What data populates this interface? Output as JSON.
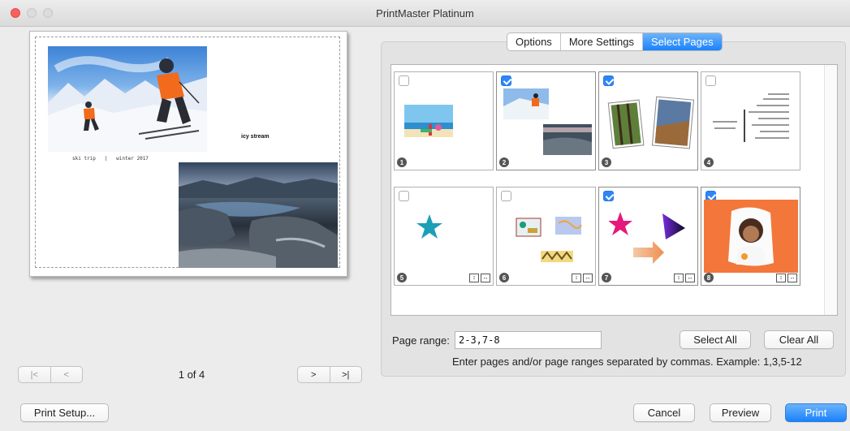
{
  "window": {
    "title": "PrintMaster Platinum"
  },
  "preview": {
    "caption_ski": "ski trip   |   winter 2017",
    "caption_stream": "icy stream",
    "page_indicator": "1 of 4",
    "nav": {
      "first": "|<",
      "prev": "<",
      "next": ">",
      "last": ">|"
    }
  },
  "tabs": [
    {
      "label": "Options",
      "selected": false
    },
    {
      "label": "More Settings",
      "selected": false
    },
    {
      "label": "Select Pages",
      "selected": true
    }
  ],
  "pages": [
    {
      "number": "1",
      "checked": false,
      "fit_controls": false
    },
    {
      "number": "2",
      "checked": true,
      "fit_controls": false
    },
    {
      "number": "3",
      "checked": true,
      "fit_controls": false
    },
    {
      "number": "4",
      "checked": false,
      "fit_controls": false
    },
    {
      "number": "5",
      "checked": false,
      "fit_controls": true
    },
    {
      "number": "6",
      "checked": false,
      "fit_controls": true
    },
    {
      "number": "7",
      "checked": true,
      "fit_controls": true
    },
    {
      "number": "8",
      "checked": true,
      "fit_controls": true
    }
  ],
  "page_range": {
    "label": "Page range:",
    "value": "2-3,7-8",
    "hint": "Enter pages and/or page ranges separated by commas. Example: 1,3,5-12"
  },
  "buttons": {
    "select_all": "Select All",
    "clear_all": "Clear All",
    "print_setup": "Print Setup...",
    "cancel": "Cancel",
    "preview": "Preview",
    "print": "Print"
  },
  "colors": {
    "accent": "#1a82fb",
    "checkbox": "#2d86f7",
    "close_button": "#fc605c"
  }
}
